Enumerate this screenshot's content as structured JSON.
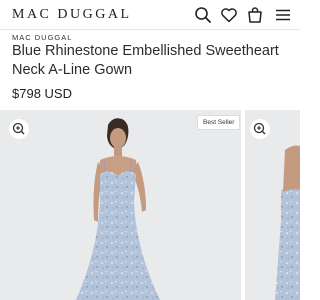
{
  "header": {
    "logo": "MAC DUGGAL",
    "icons": [
      "search-icon",
      "heart-icon",
      "bag-icon",
      "menu-icon"
    ]
  },
  "product": {
    "brand": "MAC DUGGAL",
    "title": "Blue Rhinestone Embellished Sweetheart Neck A-Line Gown",
    "price": "$798 USD"
  },
  "gallery": {
    "badge": "Best Seller",
    "zoom_icon": "zoom-in-icon",
    "dress_color": "#b3c3d9",
    "background_color": "#e9eaec"
  }
}
